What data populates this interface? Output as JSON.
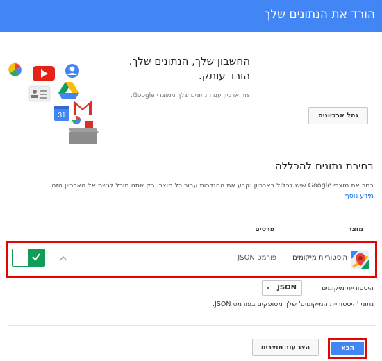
{
  "header": {
    "title": "הורד את הנתונים שלך"
  },
  "hero": {
    "heading_line1": "החשבון שלך, הנתונים שלך.",
    "heading_line2": "הורד עותק.",
    "subtitle": "צור ארכיון עם הנתונים שלך ממוצרי Google.",
    "manage_button": "נהל ארכיונים"
  },
  "selection": {
    "title": "בחירת נתונים להכללה",
    "description": "בחר את מוצרי Google שיש לכלול בארכיון וקבע את ההגדרות עבור כל מוצר. רק אתה תוכל לגשת אל הארכיון הזה.",
    "learn_more": "מידע נוסף",
    "col_product": "מוצר",
    "col_details": "פרטים"
  },
  "product_row": {
    "name": "היסטוריית מיקומים",
    "format": "פורמט JSON",
    "enabled": true
  },
  "options": {
    "label": "היסטוריית מיקומים",
    "selected_format": "JSON",
    "note": "נתוני 'היסטוריית המיקומים' שלך מסופקים בפורמט JSON."
  },
  "footer": {
    "more_products": "הצג עוד מוצרים",
    "next": "הבא"
  },
  "colors": {
    "primary": "#4285f4",
    "toggle_on": "#0f9d58",
    "highlight": "#e10600"
  }
}
